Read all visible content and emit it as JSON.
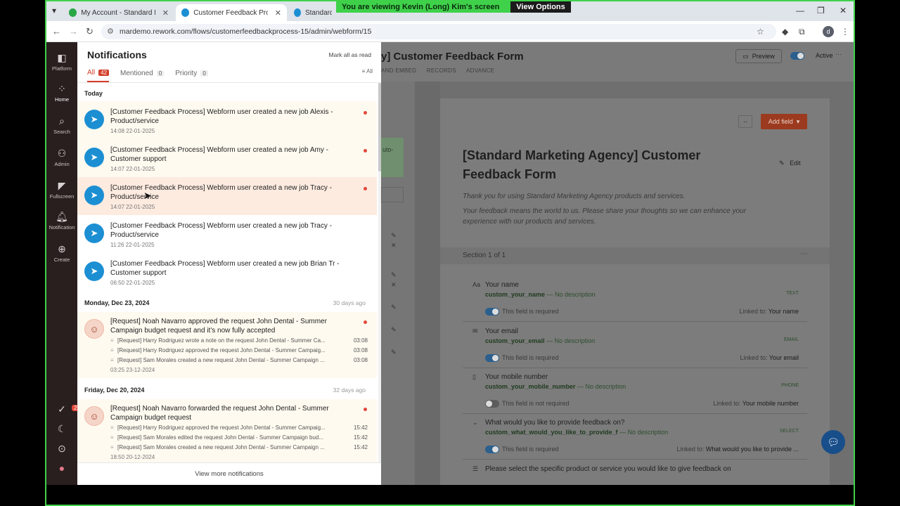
{
  "share_banner": {
    "text": "You are viewing  Kevin (Long) Kim's screen",
    "view_options": "View Options"
  },
  "browser": {
    "tabs": [
      {
        "label": "My Account - Standard Marke",
        "color": "#27a745"
      },
      {
        "label": "Customer Feedback Process - V",
        "color": "#1c8fd3"
      },
      {
        "label": "Standard M",
        "color": "#1c8fd3"
      }
    ],
    "url": "mardemo.rework.com/flows/customerfeedbackprocess-15/admin/webform/15",
    "avatar_letter": "d"
  },
  "sidebar": {
    "items": [
      {
        "label": "Platform",
        "icon": "platform-icon"
      },
      {
        "label": "Home",
        "icon": "home-grid-icon"
      },
      {
        "label": "Search",
        "icon": "search-icon"
      },
      {
        "label": "Admin",
        "icon": "admin-icon"
      },
      {
        "label": "Fullscreen",
        "icon": "fullscreen-icon"
      },
      {
        "label": "Notification",
        "icon": "bell-icon"
      },
      {
        "label": "Create",
        "icon": "plus-icon"
      }
    ],
    "badge": "2"
  },
  "notifications": {
    "title": "Notifications",
    "mark_all": "Mark all as read",
    "tabs": [
      {
        "label": "All",
        "count": "42"
      },
      {
        "label": "Mentioned",
        "count": "0"
      },
      {
        "label": "Priority",
        "count": "0"
      }
    ],
    "filter": "All",
    "groups": [
      {
        "head": "Today",
        "ago": ""
      },
      {
        "head": "Monday, Dec 23, 2024",
        "ago": "30 days ago"
      },
      {
        "head": "Friday, Dec 20, 2024",
        "ago": "32 days ago"
      }
    ],
    "items": [
      {
        "text": "[Customer Feedback Process] Webform user created a new job Alexis - Product/service",
        "time": "14:08 22-01-2025"
      },
      {
        "text": "[Customer Feedback Process] Webform user created a new job Amy - Customer support",
        "time": "14:07 22-01-2025"
      },
      {
        "text": "[Customer Feedback Process] Webform user created a new job Tracy - Product/service",
        "time": "14:07 22-01-2025"
      },
      {
        "text": "[Customer Feedback Process] Webform user created a new job Tracy - Product/service",
        "time": "11:26 22-01-2025"
      },
      {
        "text": "[Customer Feedback Process] Webform user created a new job Brian Tr - Customer support",
        "time": "06:50 22-01-2025"
      },
      {
        "text": "[Request] Noah Navarro approved the request John Dental - Summer Campaign budget request and it's now fully accepted",
        "time": "03:25 23-12-2024",
        "subs": [
          {
            "text": "[Request] Harry Rodriguez wrote a note on the request John Dental - Summer Ca...",
            "time": "03:08"
          },
          {
            "text": "[Request] Harry Rodriguez approved the request John Dental - Summer Campaig...",
            "time": "03:08"
          },
          {
            "text": "[Request] Sam Morales created a new request John Dental - Summer Campaign ...",
            "time": "03:08"
          }
        ]
      },
      {
        "text": "[Request] Noah Navarro forwarded the request John Dental - Summer Campaign budget request",
        "time": "18:50 20-12-2024",
        "subs": [
          {
            "text": "[Request] Harry Rodriguez approved the request John Dental - Summer Campaig...",
            "time": "15:42"
          },
          {
            "text": "[Request] Sam Morales edited the request John Dental - Summer Campaign bud...",
            "time": "15:42"
          },
          {
            "text": "[Request] Sam Morales created a new request John Dental - Summer Campaign ...",
            "time": "15:42"
          }
        ]
      }
    ],
    "view_more": "View more notifications"
  },
  "form": {
    "header_title": "y] Customer Feedback Form",
    "subtabs": [
      "AND EMBED",
      "RECORDS",
      "ADVANCE"
    ],
    "preview": "Preview",
    "active": "Active",
    "add_field": "Add field",
    "title": "[Standard Marketing Agency] Customer Feedback Form",
    "edit": "Edit",
    "desc1": "Thank you for using Standard Marketing Agency products and services.",
    "desc2": "Your feedback means the world to us. Please share your thoughts so we can enhance your experience with our products and services.",
    "section": "Section 1 of 1",
    "fields": [
      {
        "name": "Your name",
        "key": "custom_your_name",
        "desc": "— No description",
        "type": "TEXT",
        "req": "This field is required",
        "linked": "Your name",
        "on": true
      },
      {
        "name": "Your email",
        "key": "custom_your_email",
        "desc": "— No description",
        "type": "EMAIL",
        "req": "This field is required",
        "linked": "Your email",
        "on": true
      },
      {
        "name": "Your mobile number",
        "key": "custom_your_mobile_number",
        "desc": "— No description",
        "type": "PHONE",
        "req": "This field is not required",
        "linked": "Your mobile number",
        "on": false
      },
      {
        "name": "What would you like to provide feedback on?",
        "key": "custom_what_would_you_like_to_provide_f",
        "desc": "— No description",
        "type": "SELECT",
        "req": "This field is required",
        "linked": "What would you like to provide ...",
        "on": true
      }
    ],
    "last_field": "Please select the specific product or service you would like to give feedback on",
    "linked_prefix": "Linked to: ",
    "auto_fragment": "uto-"
  }
}
